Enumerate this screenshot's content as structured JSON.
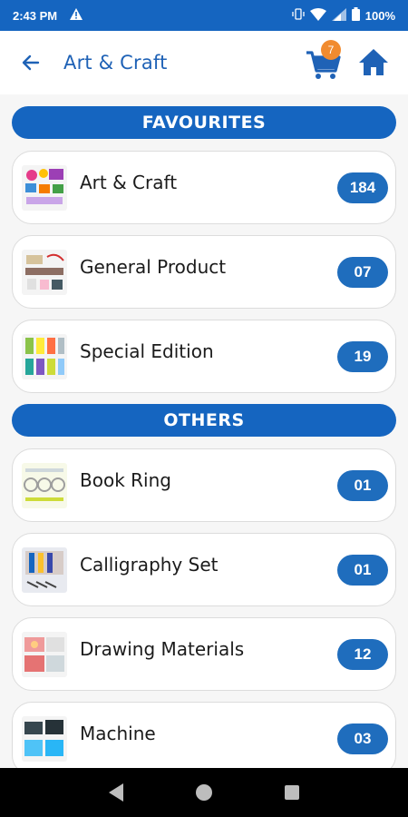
{
  "status": {
    "time": "2:43 PM",
    "battery": "100%"
  },
  "appbar": {
    "title": "Art & Craft",
    "cart_count": "7"
  },
  "sections": [
    {
      "title": "FAVOURITES",
      "items": [
        {
          "label": "Art & Craft",
          "count": "184"
        },
        {
          "label": "General Product",
          "count": "07"
        },
        {
          "label": "Special Edition",
          "count": "19"
        }
      ]
    },
    {
      "title": "OTHERS",
      "items": [
        {
          "label": "Book Ring",
          "count": "01"
        },
        {
          "label": "Calligraphy Set",
          "count": "01"
        },
        {
          "label": "Drawing Materials",
          "count": "12"
        },
        {
          "label": "Machine",
          "count": "03"
        }
      ]
    }
  ],
  "colors": {
    "primary": "#1565c0",
    "badge": "#f18b2f",
    "count_pill": "#1f6dbd"
  }
}
